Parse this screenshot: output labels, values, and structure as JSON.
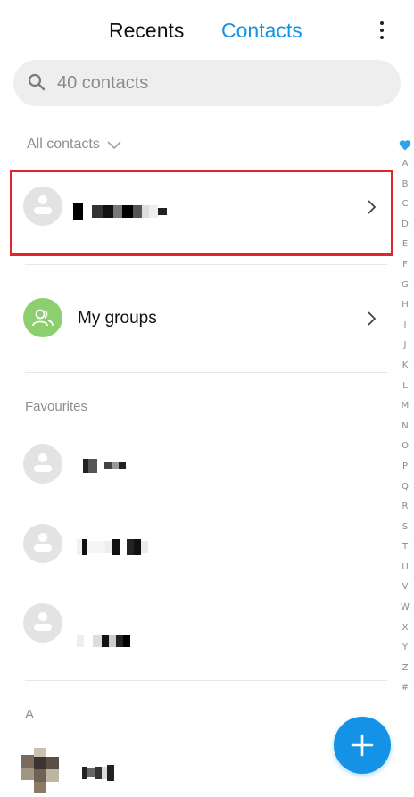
{
  "header": {
    "tabs": [
      {
        "label": "Recents",
        "active": false
      },
      {
        "label": "Contacts",
        "active": true
      }
    ],
    "accent_color": "#1493e6",
    "menu_icon": "more-vertical-icon"
  },
  "search": {
    "placeholder": "40 contacts",
    "icon": "search-icon"
  },
  "filter": {
    "label": "All contacts",
    "icon": "chevron-down-icon"
  },
  "my_contact": {
    "name_redacted": true,
    "icon": "chevron-right-icon",
    "highlight_color": "#e5232d"
  },
  "groups": {
    "label": "My groups",
    "icon": "people-icon",
    "avatar_color": "#8ccf6e"
  },
  "favourites": {
    "label": "Favourites",
    "items": [
      {
        "name_redacted": true
      },
      {
        "name_redacted": true
      },
      {
        "name_redacted": true
      }
    ]
  },
  "section_a": {
    "label": "A",
    "items": [
      {
        "name_redacted": true,
        "has_photo": true
      }
    ]
  },
  "alpha_index": [
    "A",
    "B",
    "C",
    "D",
    "E",
    "F",
    "G",
    "H",
    "I",
    "J",
    "K",
    "L",
    "M",
    "N",
    "O",
    "P",
    "Q",
    "R",
    "S",
    "T",
    "U",
    "V",
    "W",
    "X",
    "Y",
    "Z",
    "#"
  ],
  "fab": {
    "icon": "plus-icon"
  }
}
